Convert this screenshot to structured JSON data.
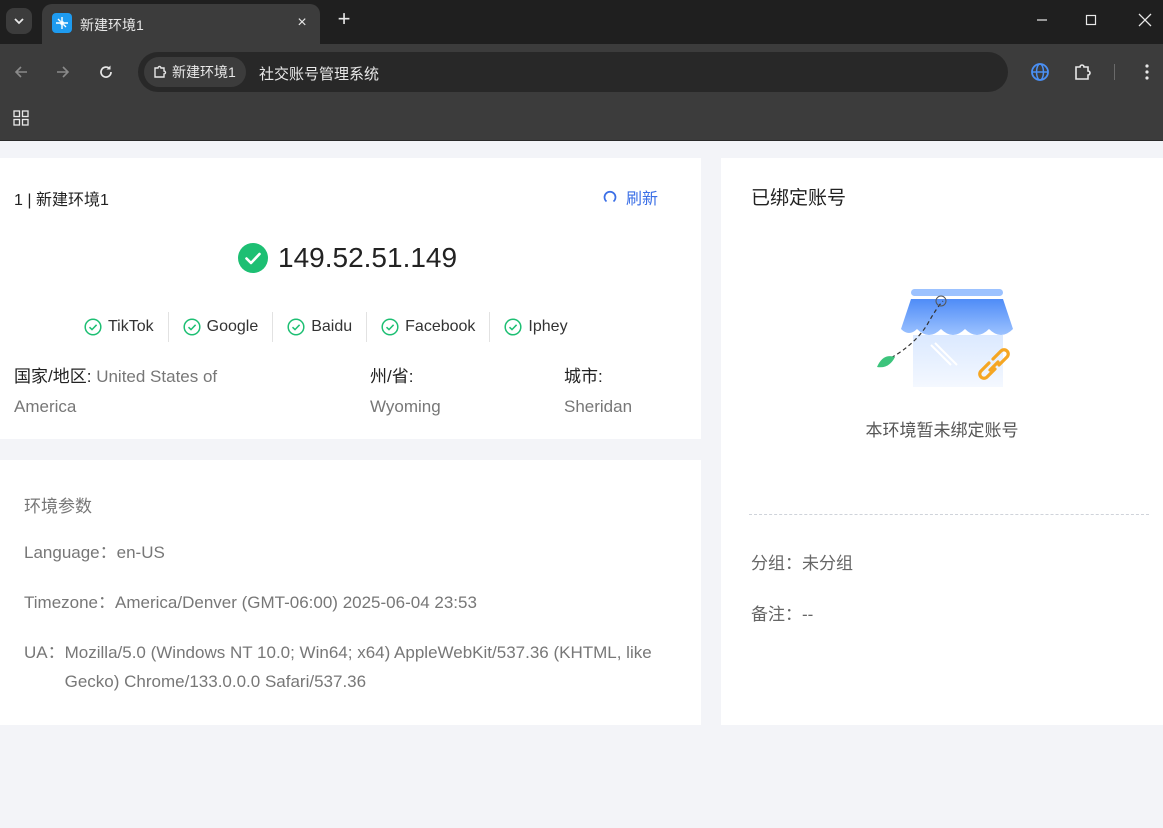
{
  "browser": {
    "tab_title": "新建环境1",
    "tab_close": "×",
    "new_tab": "+",
    "chip_label": "新建环境1",
    "url_text": "社交账号管理系统",
    "accent_color": "#1e9bf0"
  },
  "env": {
    "title": "1 | 新建环境1",
    "refresh_label": "刷新",
    "ip": "149.52.51.149",
    "sites": [
      "TikTok",
      "Google",
      "Baidu",
      "Facebook",
      "Iphey"
    ],
    "country_key": "国家/地区:",
    "country_value_line1": "United States of",
    "country_value_line2": "America",
    "state_key": "州/省:",
    "state_value": "Wyoming",
    "city_key": "城市:",
    "city_value": "Sheridan",
    "status_color": "#1dbf73"
  },
  "params": {
    "title": "环境参数",
    "language_label": "Language：",
    "language_value": "en-US",
    "timezone_label": "Timezone：",
    "timezone_value": "America/Denver (GMT-06:00) 2025-06-04 23:53",
    "ua_label": "UA：",
    "ua_value": "Mozilla/5.0 (Windows NT 10.0; Win64; x64) AppleWebKit/537.36 (KHTML, like Gecko) Chrome/133.0.0.0 Safari/537.36"
  },
  "bound": {
    "title": "已绑定账号",
    "empty_text": "本环境暂未绑定账号",
    "group_label": "分组：",
    "group_value": "未分组",
    "note_label": "备注：",
    "note_value": "--"
  }
}
